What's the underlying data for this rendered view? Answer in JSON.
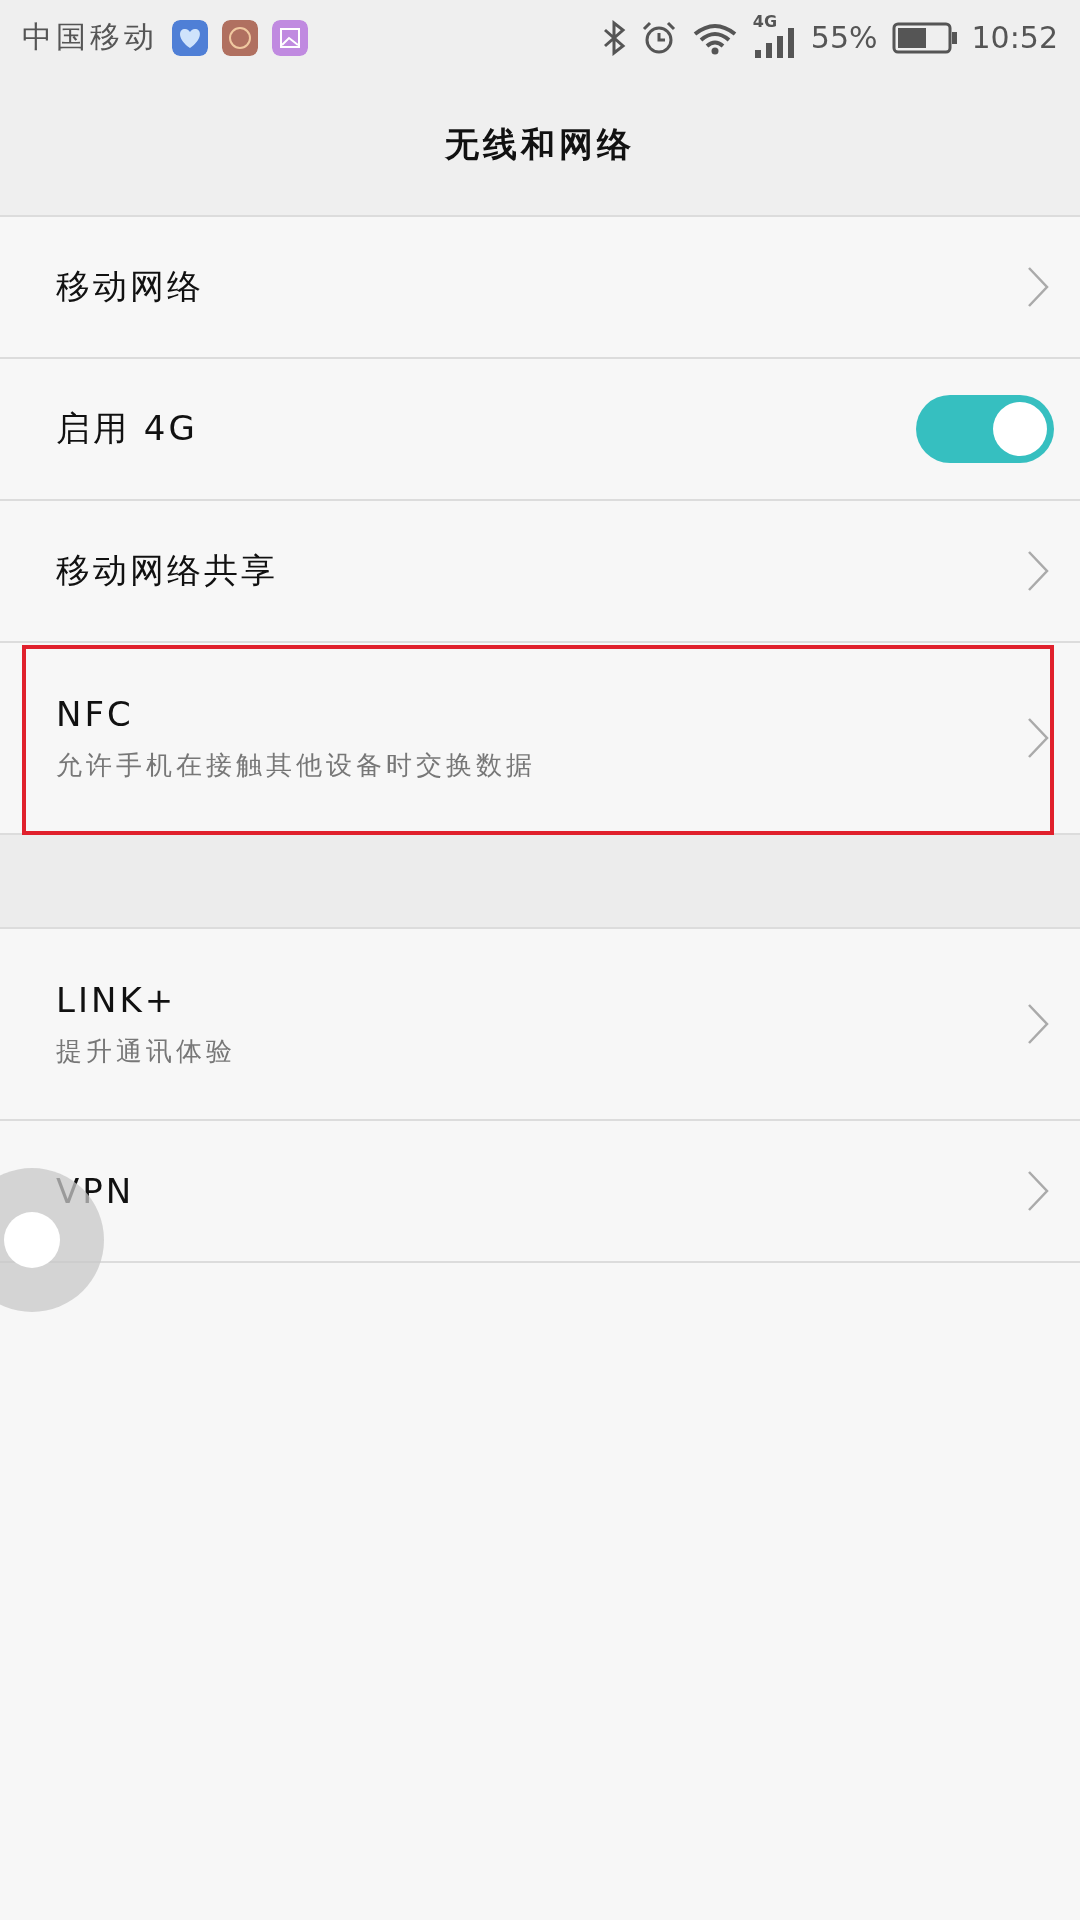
{
  "status_bar": {
    "carrier": "中国移动",
    "network": "4G",
    "battery": "55%",
    "time": "10:52"
  },
  "header": {
    "title": "无线和网络"
  },
  "sections": [
    {
      "items": [
        {
          "kind": "chevron",
          "title": "移动网络",
          "highlighted": false
        },
        {
          "kind": "toggle",
          "title": "启用 4G",
          "on": true,
          "highlighted": false
        },
        {
          "kind": "chevron",
          "title": "移动网络共享",
          "highlighted": false
        },
        {
          "kind": "chevron",
          "title": "NFC",
          "subtitle": "允许手机在接触其他设备时交换数据",
          "highlighted": true
        }
      ]
    },
    {
      "items": [
        {
          "kind": "chevron",
          "title": "LINK+",
          "subtitle": "提升通讯体验",
          "highlighted": false
        },
        {
          "kind": "chevron",
          "title": "VPN",
          "highlighted": false
        }
      ]
    }
  ]
}
